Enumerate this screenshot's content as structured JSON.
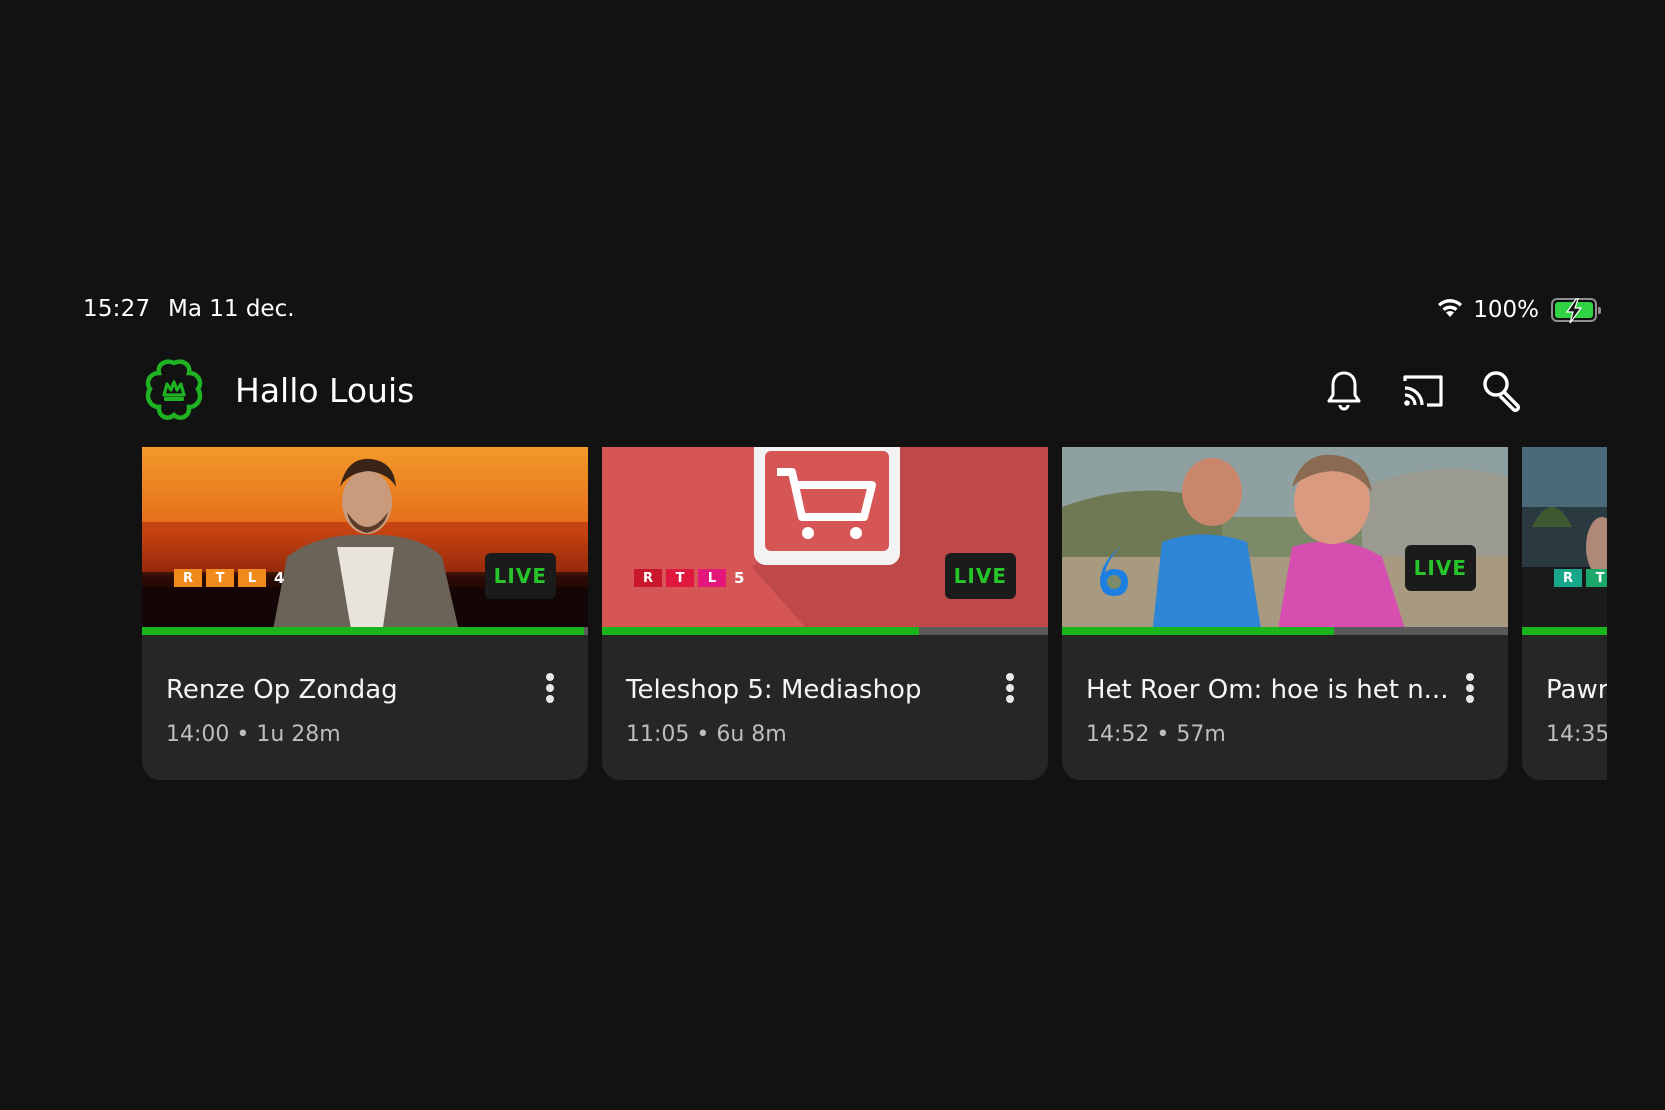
{
  "status": {
    "time": "15:27",
    "date": "Ma 11 dec.",
    "battery_pct": "100%",
    "battery_level": 1.0
  },
  "header": {
    "greeting": "Hallo Louis",
    "icons": [
      "bell-icon",
      "cast-icon",
      "search-icon"
    ]
  },
  "colors": {
    "accent": "#1ab51d",
    "background": "#121212",
    "card": "#262626"
  },
  "cards": [
    {
      "title": "Renze Op Zondag",
      "meta": "14:00 • 1u 28m",
      "badge": "LIVE",
      "channel_letters": [
        "R",
        "T",
        "L"
      ],
      "channel_num": "4",
      "progress": 0.99
    },
    {
      "title": "Teleshop 5: Mediashop",
      "meta": "11:05 • 6u 8m",
      "badge": "LIVE",
      "channel_letters": [
        "R",
        "T",
        "L"
      ],
      "channel_num": "5",
      "progress": 0.71
    },
    {
      "title": "Het Roer Om: hoe is het n...",
      "meta": "14:52 • 57m",
      "badge": "LIVE",
      "channel_num": "6",
      "progress": 0.61
    },
    {
      "title": "Pawr",
      "meta": "14:35",
      "channel_letters": [
        "R",
        "T"
      ],
      "progress": 1.0
    }
  ]
}
